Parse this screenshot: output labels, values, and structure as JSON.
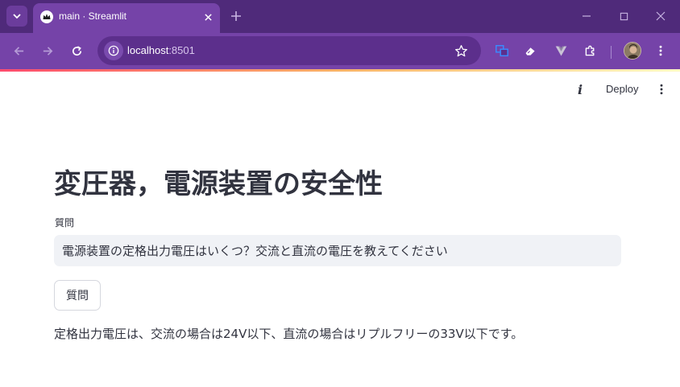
{
  "browser": {
    "tab": {
      "title": "main · Streamlit"
    },
    "address": {
      "host": "localhost",
      "port": ":8501"
    },
    "colors": {
      "tabstrip": "#4f2a7a",
      "toolbar": "#7543a8",
      "omnibox": "#5c2f8c"
    }
  },
  "app": {
    "header": {
      "deploy_label": "Deploy"
    },
    "title": "変圧器，電源装置の安全性",
    "question": {
      "label": "質問",
      "value": "電源装置の定格出力電圧はいくつ？交流と直流の電圧を教えてください"
    },
    "submit_label": "質問",
    "answer": "定格出力電圧は、交流の場合は24V以下、直流の場合はリプルフリーの33V以下です。"
  }
}
